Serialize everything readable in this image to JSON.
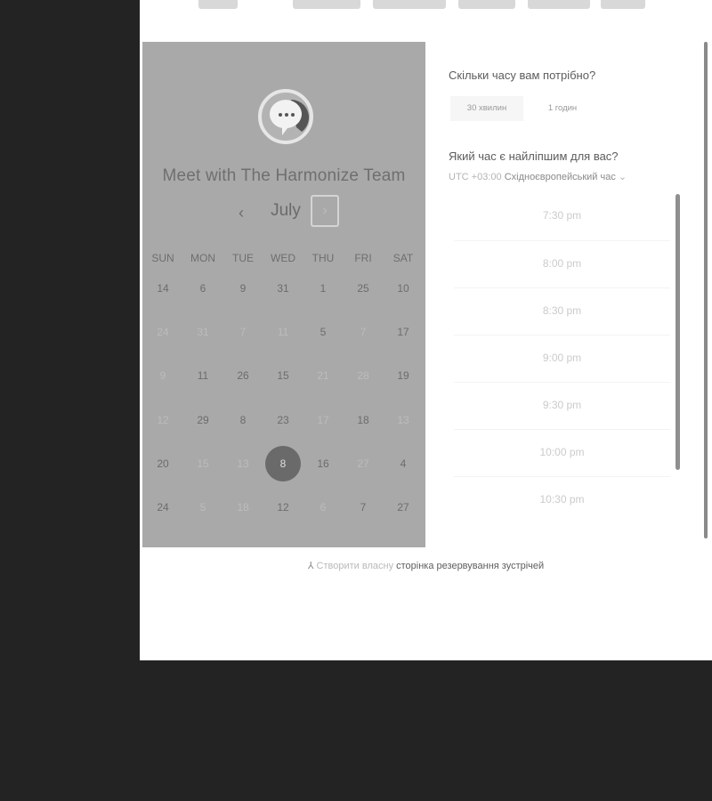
{
  "calendar": {
    "title": "Meet with The Harmonize Team",
    "month": "July",
    "prev_icon": "‹",
    "next_icon": "›",
    "weekdays": [
      "SUN",
      "MON",
      "TUE",
      "WED",
      "THU",
      "FRI",
      "SAT"
    ],
    "weeks": [
      [
        {
          "d": "14",
          "s": "normal"
        },
        {
          "d": "6",
          "s": "normal"
        },
        {
          "d": "9",
          "s": "normal"
        },
        {
          "d": "31",
          "s": "normal"
        },
        {
          "d": "1",
          "s": "normal"
        },
        {
          "d": "25",
          "s": "normal"
        },
        {
          "d": "10",
          "s": "normal"
        }
      ],
      [
        {
          "d": "24",
          "s": "dim"
        },
        {
          "d": "31",
          "s": "dim"
        },
        {
          "d": "7",
          "s": "dim"
        },
        {
          "d": "11",
          "s": "dim"
        },
        {
          "d": "5",
          "s": "normal"
        },
        {
          "d": "7",
          "s": "dim"
        },
        {
          "d": "17",
          "s": "normal"
        }
      ],
      [
        {
          "d": "9",
          "s": "dim"
        },
        {
          "d": "11",
          "s": "normal"
        },
        {
          "d": "26",
          "s": "normal"
        },
        {
          "d": "15",
          "s": "normal"
        },
        {
          "d": "21",
          "s": "dim"
        },
        {
          "d": "28",
          "s": "dim"
        },
        {
          "d": "19",
          "s": "normal"
        }
      ],
      [
        {
          "d": "12",
          "s": "dim"
        },
        {
          "d": "29",
          "s": "normal"
        },
        {
          "d": "8",
          "s": "normal"
        },
        {
          "d": "23",
          "s": "normal"
        },
        {
          "d": "17",
          "s": "dim"
        },
        {
          "d": "18",
          "s": "normal"
        },
        {
          "d": "13",
          "s": "dim"
        }
      ],
      [
        {
          "d": "20",
          "s": "normal"
        },
        {
          "d": "15",
          "s": "dim"
        },
        {
          "d": "13",
          "s": "dim"
        },
        {
          "d": "8",
          "s": "selected"
        },
        {
          "d": "16",
          "s": "normal"
        },
        {
          "d": "27",
          "s": "dim"
        },
        {
          "d": "4",
          "s": "normal"
        }
      ],
      [
        {
          "d": "24",
          "s": "normal"
        },
        {
          "d": "5",
          "s": "dim"
        },
        {
          "d": "18",
          "s": "dim"
        },
        {
          "d": "12",
          "s": "normal"
        },
        {
          "d": "6",
          "s": "dim"
        },
        {
          "d": "7",
          "s": "normal"
        },
        {
          "d": "27",
          "s": "normal"
        }
      ]
    ]
  },
  "booking": {
    "duration_question": "Скільки часу вам потрібно?",
    "durations": [
      "30 хвилин",
      "1 годин"
    ],
    "time_question": "Який час є найліпшим для вас?",
    "timezone_offset": "UTC +03:00",
    "timezone_name": "Східноєвропейський час",
    "timezone_caret": "⌄",
    "slots": [
      "7:30 pm",
      "8:00 pm",
      "8:30 pm",
      "9:00 pm",
      "9:30 pm",
      "10:00 pm",
      "10:30 pm"
    ]
  },
  "footer": {
    "icon": "⅄",
    "prefix": "Створити власну",
    "link": "сторінка резервування зустрічей"
  },
  "colors": {
    "page_background": "#232323",
    "panel_background": "#a9a9a9",
    "selected_day": "#6a6a6a"
  }
}
